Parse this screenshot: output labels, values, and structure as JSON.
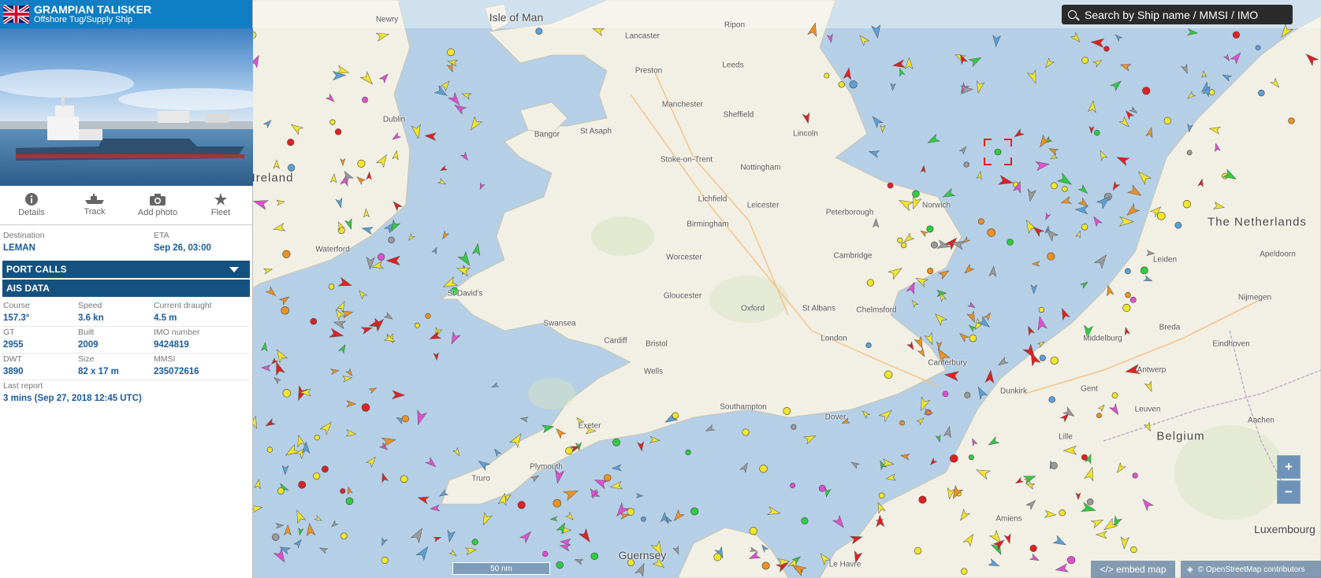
{
  "vessel": {
    "name": "GRAMPIAN TALISKER",
    "type": "Offshore Tug/Supply Ship"
  },
  "actions": [
    {
      "label": "Details",
      "icon": "info-icon"
    },
    {
      "label": "Track",
      "icon": "ship-track-icon"
    },
    {
      "label": "Add photo",
      "icon": "camera-icon"
    },
    {
      "label": "Fleet",
      "icon": "star-icon"
    }
  ],
  "voyage": {
    "destination_label": "Destination",
    "destination": "LEMAN",
    "eta_label": "ETA",
    "eta": "Sep 26, 03:00"
  },
  "sections": {
    "port_calls": "PORT CALLS",
    "ais_data": "AIS DATA"
  },
  "ais": {
    "course_label": "Course",
    "course": "157.3°",
    "speed_label": "Speed",
    "speed": "3.6 kn",
    "draught_label": "Current draught",
    "draught": "4.5 m",
    "gt_label": "GT",
    "gt": "2955",
    "built_label": "Built",
    "built": "2009",
    "imo_label": "IMO number",
    "imo": "9424819",
    "dwt_label": "DWT",
    "dwt": "3890",
    "size_label": "Size",
    "size": "82 x 17 m",
    "mmsi_label": "MMSI",
    "mmsi": "235072616",
    "last_report_label": "Last report",
    "last_report": "3 mins (Sep 27, 2018 12:45 UTC)"
  },
  "map": {
    "search_placeholder": "Search by Ship name / MMSI / IMO",
    "zoom_in": "+",
    "zoom_out": "−",
    "embed_label": "</> embed map",
    "attribution": "© OpenStreetMap contributors",
    "scale_label": "50 nm",
    "places": [
      "Isle of Man",
      "Newry",
      "Ripon",
      "Lancaster",
      "Leeds",
      "Preston",
      "Manchester",
      "Sheffield",
      "Dublin",
      "Bangor",
      "St Asaph",
      "Lincoln",
      "Stoke-on-Trent",
      "Nottingham",
      "Ireland",
      "Lichfield",
      "Leicester",
      "Peterborough",
      "Norwich",
      "Birmingham",
      "Waterford",
      "Cambridge",
      "Worcester",
      "St David's",
      "Gloucester",
      "Oxford",
      "St Albans",
      "Chelmsford",
      "Swansea",
      "Cardiff",
      "Bristol",
      "London",
      "Wells",
      "Canterbury",
      "Southampton",
      "Exeter",
      "Truro",
      "Plymouth",
      "Guernsey",
      "Lille",
      "Gent",
      "Leuven",
      "Aachen",
      "Belgium",
      "Breda",
      "Eindhoven",
      "Nijmegen",
      "Apeldoorn",
      "The Netherlands",
      "Leiden",
      "Amiens",
      "Luxembourg",
      "Middelburg",
      "Antwerp",
      "Dunkirk",
      "Dover",
      "Le Havre"
    ]
  },
  "colors": {
    "header_blue": "#0f7ec4",
    "section_navy": "#14517f",
    "value_blue": "#1a5a9a",
    "sea": "#b5cfe6",
    "land": "#f2efe4"
  }
}
